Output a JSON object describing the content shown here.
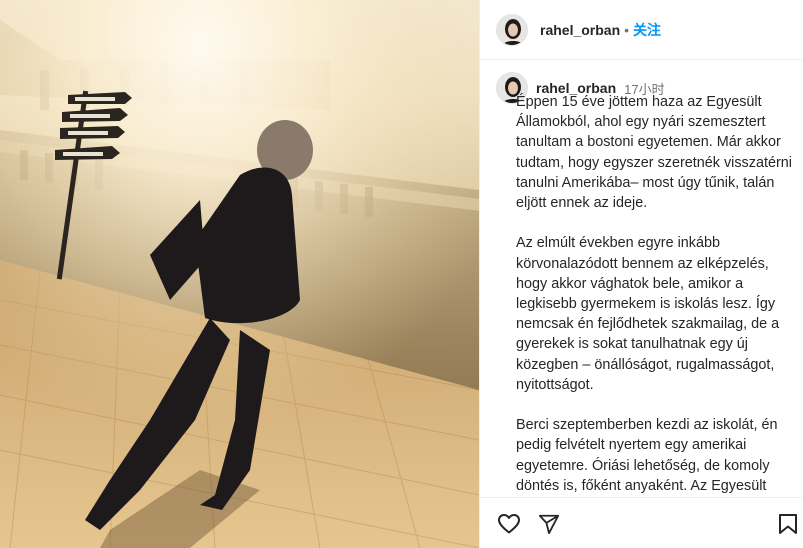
{
  "post": {
    "username": "rahel_orban",
    "follow_label": "关注",
    "separator": "•",
    "time": "17小时",
    "caption_paragraphs": [
      "Éppen 15 éve jöttem haza az Egyesült Államokból, ahol egy nyári szemesztert tanultam a bostoni egyetemen. Már akkor tudtam, hogy egyszer szeretnék visszatérni tanulni Amerikába– most úgy tűnik, talán eljött ennek az ideje.",
      "Az elmúlt években egyre inkább körvonalazódott bennem az elképzelés, hogy akkor vághatok bele, amikor a legkisebb gyermekem is iskolás lesz. Így nemcsak én fejlődhetek szakmailag, de a gyerekek is sokat tanulhatnak egy új közegben – önállóságot, rugalmasságot, nyitottságot.",
      "Berci szeptemberben kezdi az iskolát, én pedig felvételt nyertem egy amerikai egyetemre. Óriási lehetőség, de komoly döntés is, főként anyaként. Az Egyesült Államokban"
    ]
  },
  "actions": {
    "like_icon": "heart-icon",
    "share_icon": "paper-plane-icon",
    "save_icon": "bookmark-icon"
  },
  "colors": {
    "follow": "#0095f6",
    "text": "#262626",
    "muted": "#737373",
    "border": "#efefef"
  }
}
